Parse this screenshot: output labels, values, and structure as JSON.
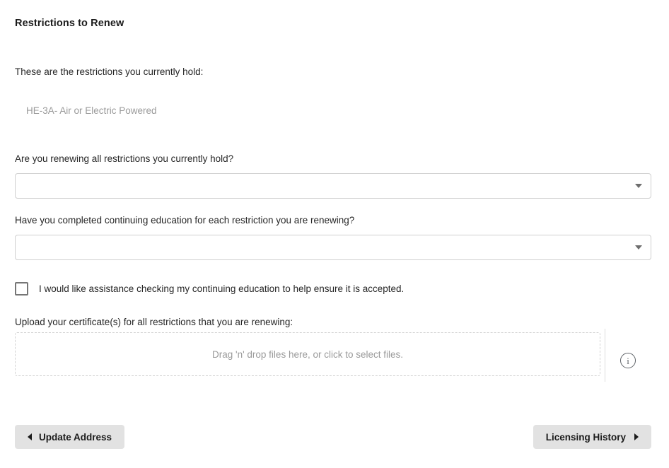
{
  "page": {
    "title": "Restrictions to Renew"
  },
  "current_restrictions": {
    "intro": "These are the restrictions you currently hold:",
    "items": [
      "HE-3A- Air or Electric Powered"
    ]
  },
  "questions": [
    {
      "label": "Are you renewing all restrictions you currently hold?",
      "value": ""
    },
    {
      "label": "Have you completed continuing education for each restriction you are renewing?",
      "value": ""
    }
  ],
  "assistance_checkbox": {
    "label": "I would like assistance checking my continuing education to help ensure it is accepted.",
    "checked": false
  },
  "upload": {
    "label": "Upload your certificate(s) for all restrictions that you are renewing:",
    "dropzone_text": "Drag 'n' drop files here, or click to select files.",
    "info_icon": "info-icon",
    "info_glyph": "i"
  },
  "navigation": {
    "previous_label": "Update Address",
    "next_label": "Licensing History"
  }
}
